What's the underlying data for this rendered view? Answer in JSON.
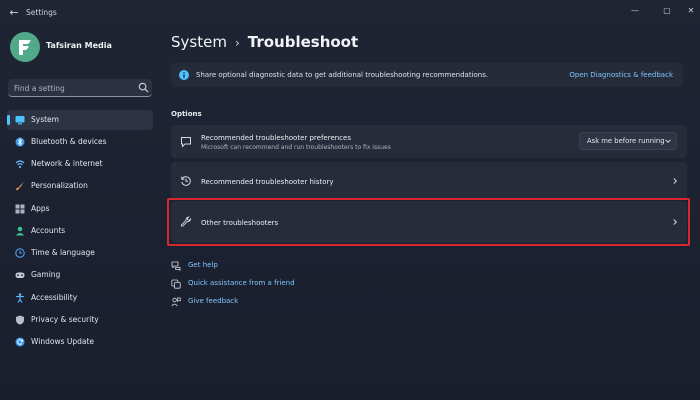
{
  "window": {
    "title": "Settings",
    "back_glyph": "←",
    "controls": {
      "minimize": "—",
      "maximize": "▢",
      "close": "✕"
    }
  },
  "profile": {
    "name": "Tafsiran Media",
    "avatar_icon": "profile-logo-icon"
  },
  "search": {
    "placeholder": "Find a setting",
    "icon": "search-icon"
  },
  "sidebar": {
    "items": [
      {
        "label": "System",
        "icon": "system-icon",
        "color": "#4cc2ff",
        "active": true
      },
      {
        "label": "Bluetooth & devices",
        "icon": "bluetooth-icon",
        "color": "#3c9cf0"
      },
      {
        "label": "Network & internet",
        "icon": "network-icon",
        "color": "#6cb7f5"
      },
      {
        "label": "Personalization",
        "icon": "brush-icon",
        "color": "#e8a35a"
      },
      {
        "label": "Apps",
        "icon": "apps-icon",
        "color": "#aab4c4"
      },
      {
        "label": "Accounts",
        "icon": "accounts-icon",
        "color": "#3fbf8f"
      },
      {
        "label": "Time & language",
        "icon": "time-language-icon",
        "color": "#4c9ff0"
      },
      {
        "label": "Gaming",
        "icon": "gaming-icon",
        "color": "#c8ccd4"
      },
      {
        "label": "Accessibility",
        "icon": "accessibility-icon",
        "color": "#5fb4f5"
      },
      {
        "label": "Privacy & security",
        "icon": "shield-icon",
        "color": "#b9bec8"
      },
      {
        "label": "Windows Update",
        "icon": "update-icon",
        "color": "#3c9cf0"
      }
    ]
  },
  "breadcrumb": {
    "parent": "System",
    "separator": "›",
    "current": "Troubleshoot"
  },
  "banner": {
    "text": "Share optional diagnostic data to get additional troubleshooting recommendations.",
    "link": "Open Diagnostics & feedback"
  },
  "options": {
    "heading": "Options",
    "cards": [
      {
        "title": "Recommended troubleshooter preferences",
        "subtitle": "Microsoft can recommend and run troubleshooters to fix issues",
        "icon": "chat-bubble-icon",
        "dropdown_value": "Ask me before running"
      },
      {
        "title": "Recommended troubleshooter history",
        "icon": "history-icon"
      },
      {
        "title": "Other troubleshooters",
        "icon": "wrench-icon",
        "highlighted": true
      }
    ]
  },
  "help_links": [
    {
      "label": "Get help",
      "icon": "help-icon"
    },
    {
      "label": "Quick assistance from a friend",
      "icon": "quick-assist-icon"
    },
    {
      "label": "Give feedback",
      "icon": "feedback-icon"
    }
  ],
  "colors": {
    "accent": "#4cc2ff",
    "link": "#7fc7ff",
    "highlight": "#d7272f"
  }
}
